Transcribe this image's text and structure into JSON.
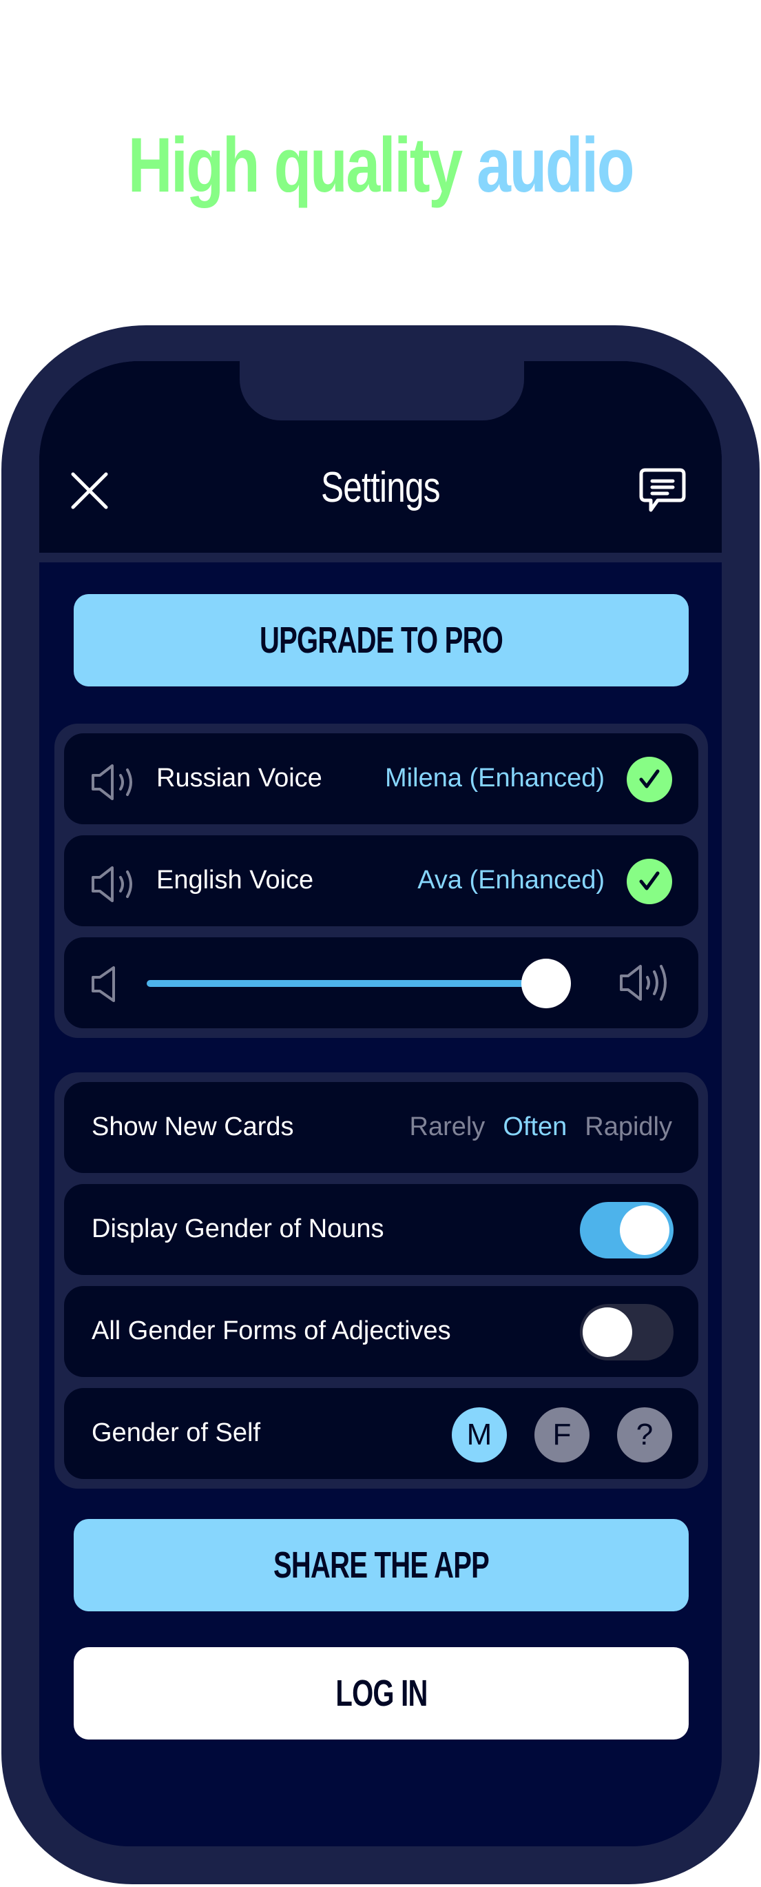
{
  "headline": {
    "part1": "High quality",
    "part2": "audio"
  },
  "colors": {
    "accent_green": "#87fd85",
    "accent_blue": "#87d6fd",
    "slider_blue": "#4db3eb",
    "bezel": "#1b2249",
    "screen": "#00093a",
    "muted": "#808397"
  },
  "nav": {
    "title": "Settings",
    "close_icon": "close-icon",
    "feedback_icon": "chat-bubble-icon"
  },
  "buttons": {
    "upgrade": "UPGRADE TO PRO",
    "share": "SHARE THE APP",
    "login": "LOG IN"
  },
  "voices": [
    {
      "label": "Russian Voice",
      "value": "Milena (Enhanced)",
      "status_icon": "check-icon"
    },
    {
      "label": "English Voice",
      "value": "Ava (Enhanced)",
      "status_icon": "check-icon"
    }
  ],
  "volume": {
    "level_percent": 93,
    "low_icon": "speaker-low-icon",
    "high_icon": "speaker-high-icon"
  },
  "settings": {
    "show_new_cards": {
      "label": "Show New Cards",
      "options": [
        "Rarely",
        "Often",
        "Rapidly"
      ],
      "selected": "Often"
    },
    "display_gender_nouns": {
      "label": "Display Gender of Nouns",
      "enabled": true
    },
    "all_gender_adjectives": {
      "label": "All Gender Forms of Adjectives",
      "enabled": false
    },
    "gender_of_self": {
      "label": "Gender of Self",
      "options": [
        "M",
        "F",
        "?"
      ],
      "selected": "M"
    }
  }
}
